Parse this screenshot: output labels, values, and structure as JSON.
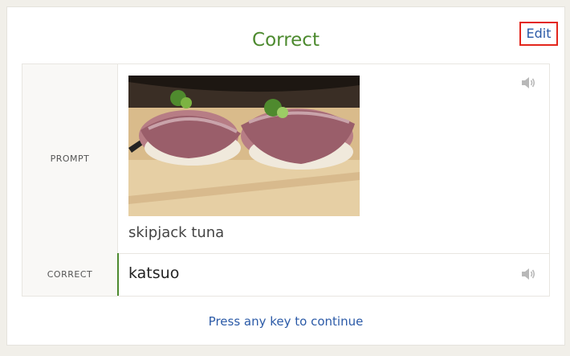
{
  "header": {
    "title": "Correct",
    "edit_label": "Edit"
  },
  "rows": {
    "prompt": {
      "label": "PROMPT",
      "text": "skipjack tuna",
      "image_icon": "sushi-photo"
    },
    "correct": {
      "label": "CORRECT",
      "text": "katsuo"
    }
  },
  "footer": {
    "continue_text": "Press any key to continue"
  },
  "colors": {
    "title": "#4d8a2f",
    "link": "#2b5aa7",
    "edit_outline": "#e3261c",
    "correct_bar": "#4d8a2f"
  },
  "icons": {
    "audio": "speaker-icon"
  }
}
